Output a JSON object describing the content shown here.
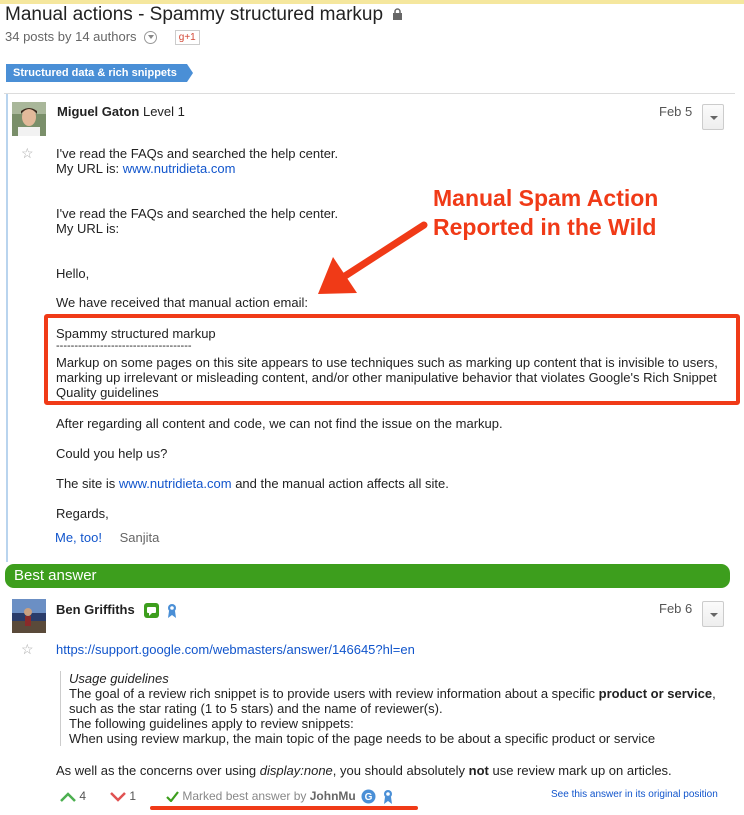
{
  "thread": {
    "title": "Manual actions - Spammy structured markup",
    "meta": "34 posts by 14 authors",
    "gplus_label": "g+1",
    "tag": "Structured data & rich snippets"
  },
  "post1": {
    "author": "Miguel Gaton",
    "level": "Level 1",
    "date": "Feb 5",
    "lines": [
      "I've read the FAQs and searched the help center.",
      "My URL is: ",
      "I've read the FAQs and searched the help center.",
      "My URL is:",
      "Hello,",
      "We have received that manual action email:",
      "Spammy structured markup",
      "-------------------------------------",
      "Markup on some pages on this site appears to use techniques such as marking up content that is invisible to users,",
      "marking up irrelevant or misleading content, and/or other manipulative behavior that violates Google's Rich Snippet",
      "Quality guidelines",
      "After regarding all content and code, we can not find the issue on the markup.",
      "Could you help us?",
      "The site is ",
      " and the manual action affects all site.",
      "Regards,"
    ],
    "url": "www.nutridieta.com",
    "me_too": "Me, too!",
    "me_too_user": "Sanjita"
  },
  "annotation": {
    "callout_line1": "Manual Spam Action",
    "callout_line2": "Reported in the Wild",
    "color": "#f03a17"
  },
  "best_answer": {
    "header": "Best answer",
    "author": "Ben Griffiths",
    "date": "Feb 6",
    "link": "https://support.google.com/webmasters/answer/146645?hl=en",
    "quote_title": "Usage guidelines",
    "quote_line1_a": "The goal of a review rich snippet is to provide users with review information about a specific ",
    "quote_line1_b": "product or service",
    "quote_line1_c": ",",
    "quote_line2": "such as the star rating (1 to 5 stars) and the name of reviewer(s).",
    "quote_line3": "The following guidelines apply to review snippets:",
    "quote_line4": "When using review markup, the main topic of the page needs to be about a specific product or service",
    "body_a": "As well as the concerns over using ",
    "body_b": "display:none",
    "body_c": ", you should absolutely ",
    "body_d": "not",
    "body_e": " use review mark up on articles.",
    "upvotes": "4",
    "downvotes": "1",
    "marked_by_label": "Marked best answer by ",
    "marked_by_user": "JohnMu",
    "original_position_link": "See this answer in its original position",
    "accent": "#3d9e1d"
  }
}
